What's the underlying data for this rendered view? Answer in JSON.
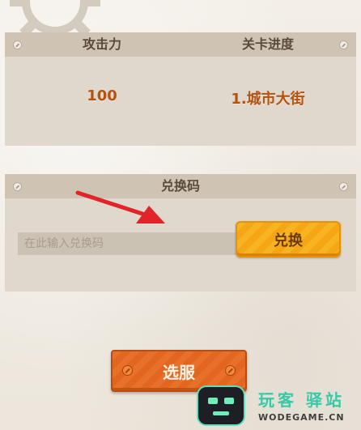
{
  "stats_panel": {
    "attack_header": "攻击力",
    "progress_header": "关卡进度",
    "attack_value": "100",
    "progress_value": "1.城市大街"
  },
  "redeem_panel": {
    "title": "兑换码",
    "input_placeholder": "在此输入兑换码",
    "input_value": "",
    "exchange_button": "兑换"
  },
  "select_server_button": "选服",
  "watermark": {
    "brand": "玩客 驿站",
    "domain": "WODEGAME.CN"
  },
  "colors": {
    "exchange_button": "#f7b321",
    "select_button": "#e8702a",
    "value_text": "#b4520e",
    "pointer_arrow": "#e0242a"
  },
  "icons": [
    "gear-icon",
    "bolt-icon",
    "pointer-arrow-icon",
    "robot-logo-icon"
  ]
}
